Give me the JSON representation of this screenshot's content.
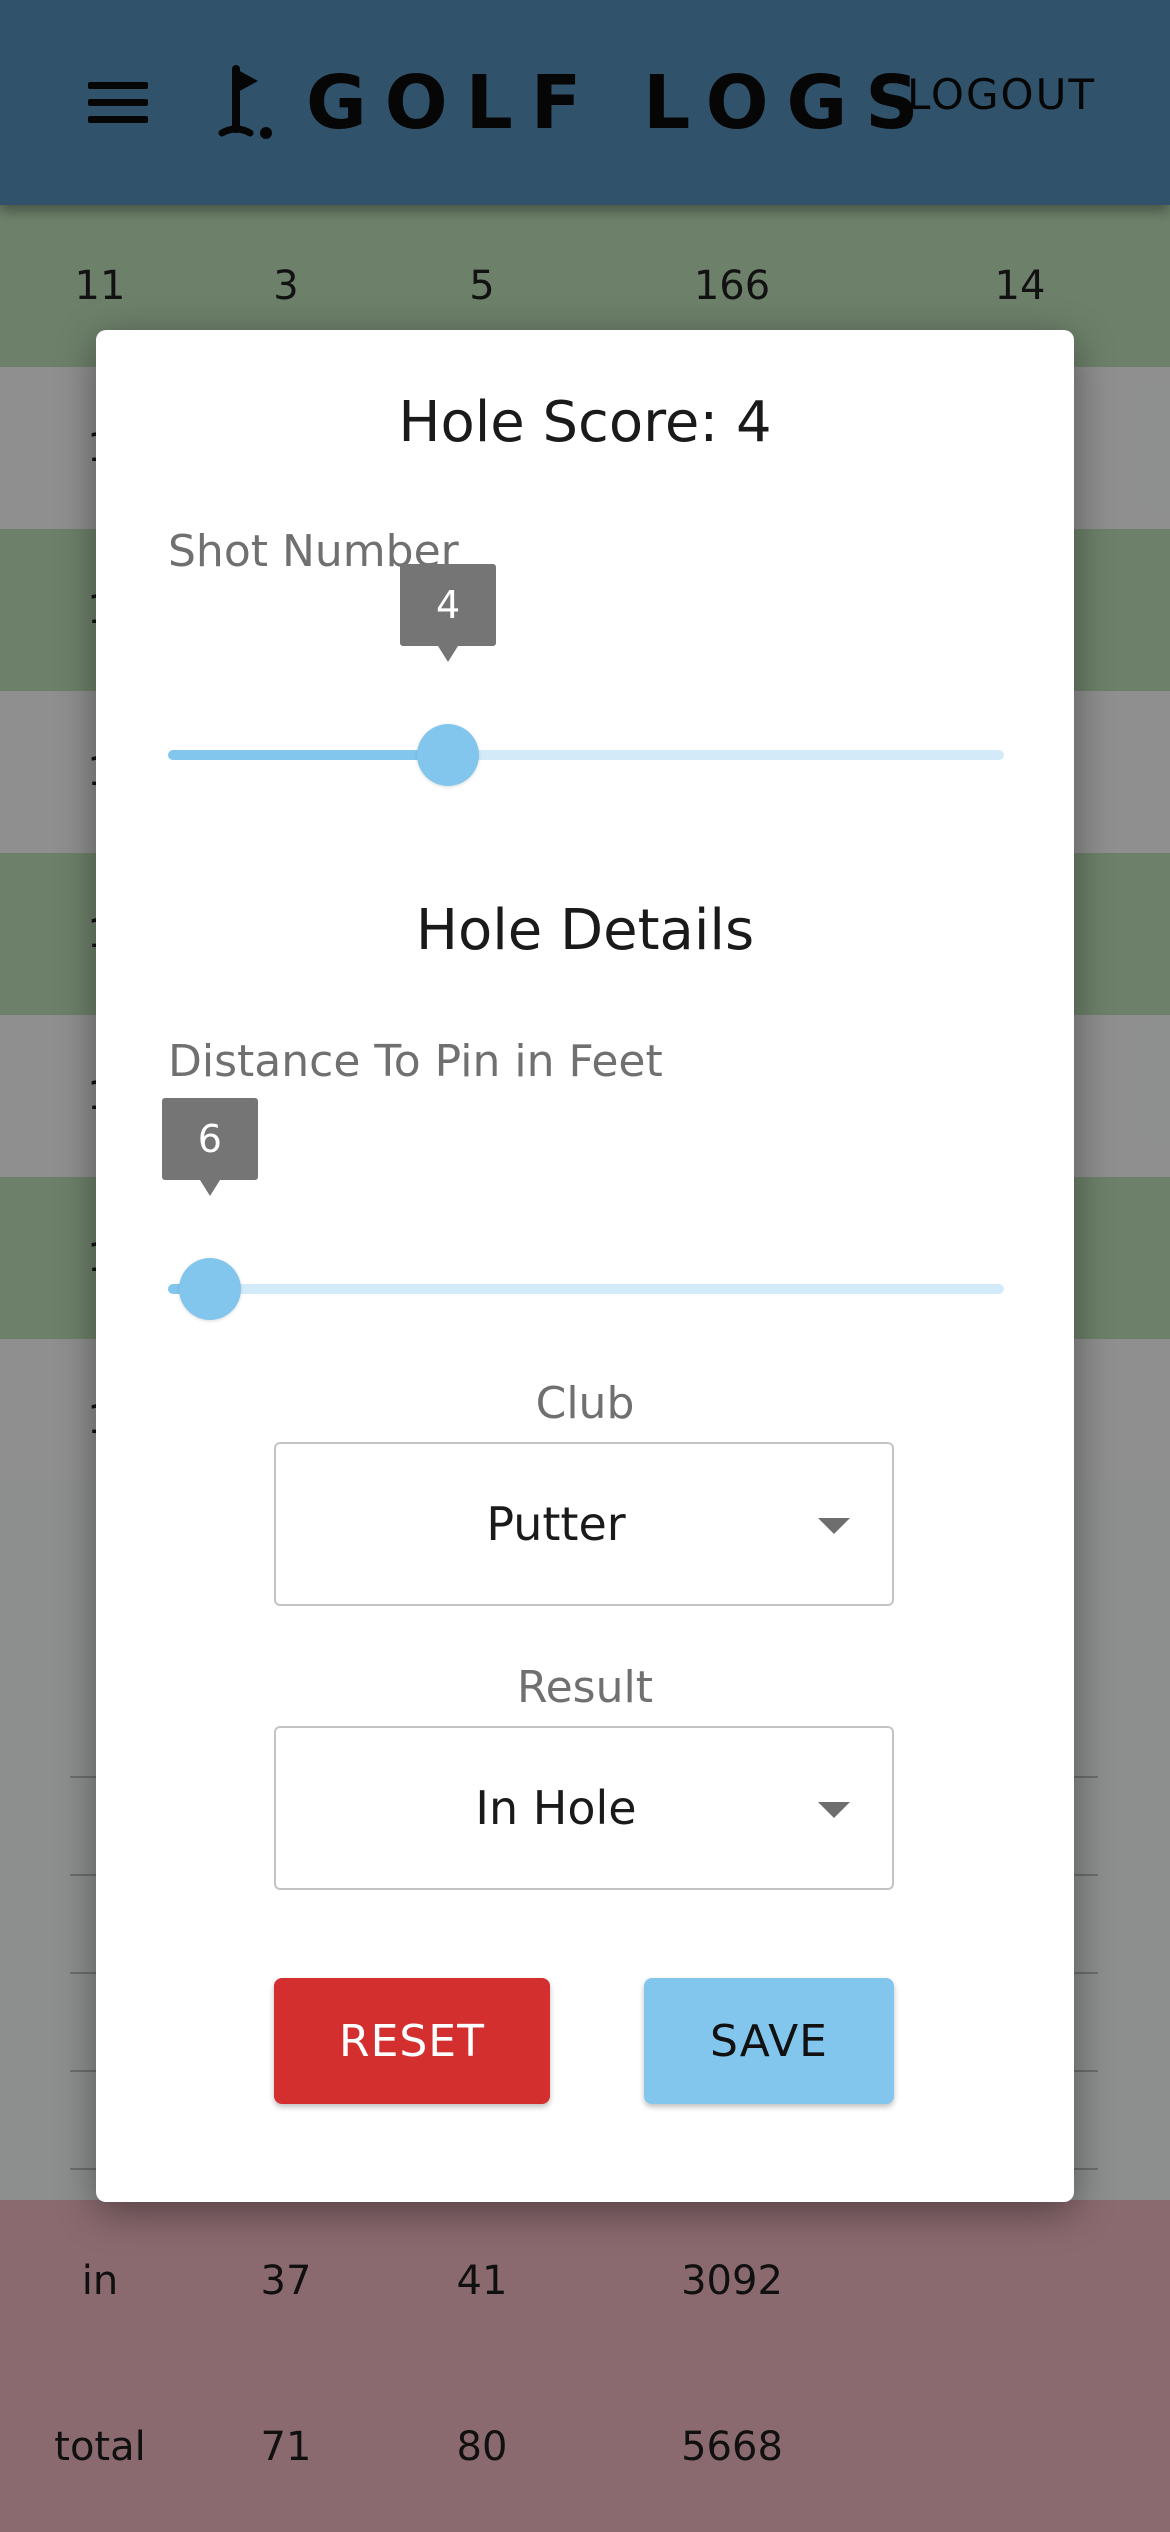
{
  "app": {
    "title": "GOLF LOGS",
    "logout_label": "LOGOUT",
    "colors": {
      "appbar": "#4a7fa3",
      "accent": "#82c6ee",
      "danger": "#d32f2f"
    }
  },
  "table": {
    "top_row": [
      "11",
      "3",
      "5",
      "166",
      "14"
    ],
    "partial_rows": [
      "1",
      "1",
      "1",
      "1",
      "1",
      "1",
      "1"
    ],
    "summary": [
      {
        "label": "in",
        "par": "37",
        "score": "41",
        "yards": "3092"
      },
      {
        "label": "total",
        "par": "71",
        "score": "80",
        "yards": "5668"
      }
    ]
  },
  "dialog": {
    "title": "Hole Score: 4",
    "shot_number": {
      "label": "Shot Number",
      "value": "4",
      "fraction": 0.335
    },
    "section_title": "Hole Details",
    "distance": {
      "label": "Distance To Pin in Feet",
      "value": "6",
      "fraction": 0.05
    },
    "club": {
      "label": "Club",
      "value": "Putter"
    },
    "result": {
      "label": "Result",
      "value": "In Hole"
    },
    "reset_label": "RESET",
    "save_label": "SAVE"
  }
}
